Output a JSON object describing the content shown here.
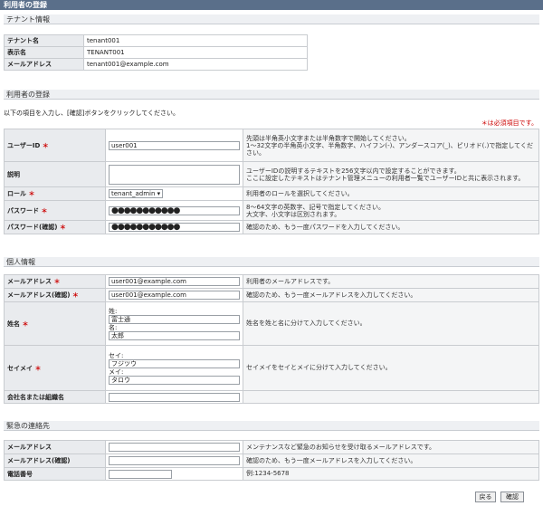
{
  "window": {
    "title": "利用者の登録"
  },
  "tenant": {
    "heading": "テナント情報",
    "rows": [
      {
        "label": "テナント名",
        "value": "tenant001"
      },
      {
        "label": "表示名",
        "value": "TENANT001"
      },
      {
        "label": "メールアドレス",
        "value": "tenant001@example.com"
      }
    ]
  },
  "user_reg": {
    "heading": "利用者の登録",
    "instruction": "以下の項目を入力し、[確認]ボタンをクリックしてください。",
    "required_note": "＊は必須項目です。",
    "required_mark": "＊",
    "fields": {
      "user_id": {
        "label": "ユーザーID",
        "value": "user001",
        "note1": "先頭は半角英小文字または半角数字で開始してください。",
        "note2": "1〜32文字の半角英小文字、半角数字、ハイフン(-)、アンダースコア(_)、ピリオド(.)で指定してください。"
      },
      "description": {
        "label": "説明",
        "value": "",
        "note1": "ユーザーIDの説明するテキストを256文字以内で設定することができます。",
        "note2": "ここに設定したテキストはテナント管理メニューの利用者一覧でユーザーIDと共に表示されます。"
      },
      "role": {
        "label": "ロール",
        "value": "tenant_admin",
        "note": "利用者のロールを選択してください。"
      },
      "password": {
        "label": "パスワード",
        "value": "●●●●●●●●●●●",
        "note1": "8〜64文字の英数字、記号で指定してください。",
        "note2": "大文字、小文字は区別されます。"
      },
      "password_confirm": {
        "label": "パスワード(確認)",
        "value": "●●●●●●●●●●●",
        "note": "確認のため、もう一度パスワードを入力してください。"
      }
    }
  },
  "personal": {
    "heading": "個人情報",
    "email": {
      "label": "メールアドレス",
      "value": "user001@example.com",
      "note": "利用者のメールアドレスです。"
    },
    "email_confirm": {
      "label": "メールアドレス(確認)",
      "value": "user001@example.com",
      "note": "確認のため、もう一度メールアドレスを入力してください。"
    },
    "name": {
      "label": "姓名",
      "sei_label": "姓:",
      "sei_value": "富士通",
      "mei_label": "名:",
      "mei_value": "太郎",
      "note": "姓名を姓と名に分けて入力してください。"
    },
    "kana": {
      "label": "セイメイ",
      "sei_label": "セイ:",
      "sei_value": "フジツウ",
      "mei_label": "メイ:",
      "mei_value": "タロウ",
      "note": "セイメイをセイとメイに分けて入力してください。"
    },
    "company": {
      "label": "会社名または組織名",
      "value": ""
    }
  },
  "emergency": {
    "heading": "緊急の連絡先",
    "email": {
      "label": "メールアドレス",
      "value": "",
      "note": "メンテナンスなど緊急のお知らせを受け取るメールアドレスです。"
    },
    "email_confirm": {
      "label": "メールアドレス(確認)",
      "value": "",
      "note": "確認のため、もう一度メールアドレスを入力してください。"
    },
    "phone": {
      "label": "電話番号",
      "value": "",
      "note": "例:1234-5678"
    }
  },
  "buttons": {
    "back": "戻る",
    "confirm": "確認"
  }
}
